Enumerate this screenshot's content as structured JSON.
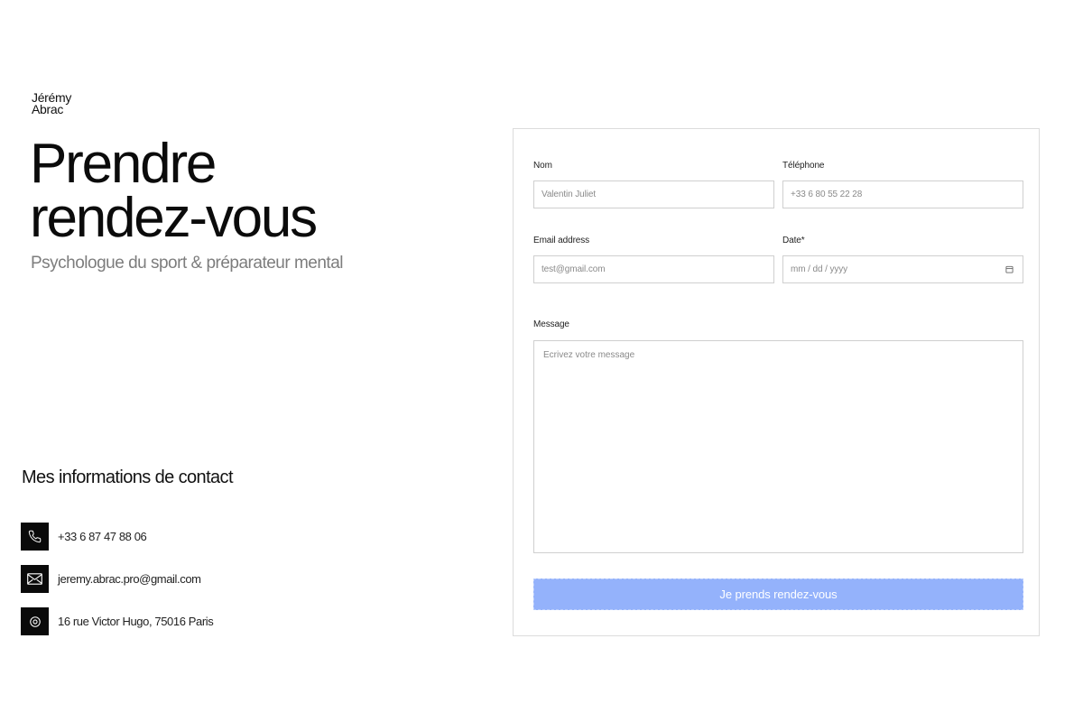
{
  "brand": {
    "line1": "Jérémy",
    "line2": "Abrac"
  },
  "hero": {
    "title_line1": "Prendre",
    "title_line2": "rendez-vous",
    "subtitle": "Psychologue du sport & préparateur mental"
  },
  "contact": {
    "heading": "Mes informations de contact",
    "items": [
      {
        "icon": "phone-icon",
        "text": "+33 6 87 47 88 06"
      },
      {
        "icon": "mail-icon",
        "text": "jeremy.abrac.pro@gmail.com"
      },
      {
        "icon": "location-pin-icon",
        "text": "16 rue Victor Hugo, 75016 Paris"
      }
    ]
  },
  "form": {
    "name": {
      "label": "Nom",
      "placeholder": "Valentin Juliet"
    },
    "phone": {
      "label": "Téléphone",
      "placeholder": "+33 6 80 55 22 28"
    },
    "email": {
      "label": "Email address",
      "placeholder": "test@gmail.com"
    },
    "date": {
      "label": "Date*",
      "placeholder": "mm / dd / yyyy",
      "icon": "calendar-icon"
    },
    "message": {
      "label": "Message",
      "placeholder": "Ecrivez votre message"
    },
    "submit_label": "Je prends rendez-vous",
    "submit_color": "#94b2fb"
  }
}
